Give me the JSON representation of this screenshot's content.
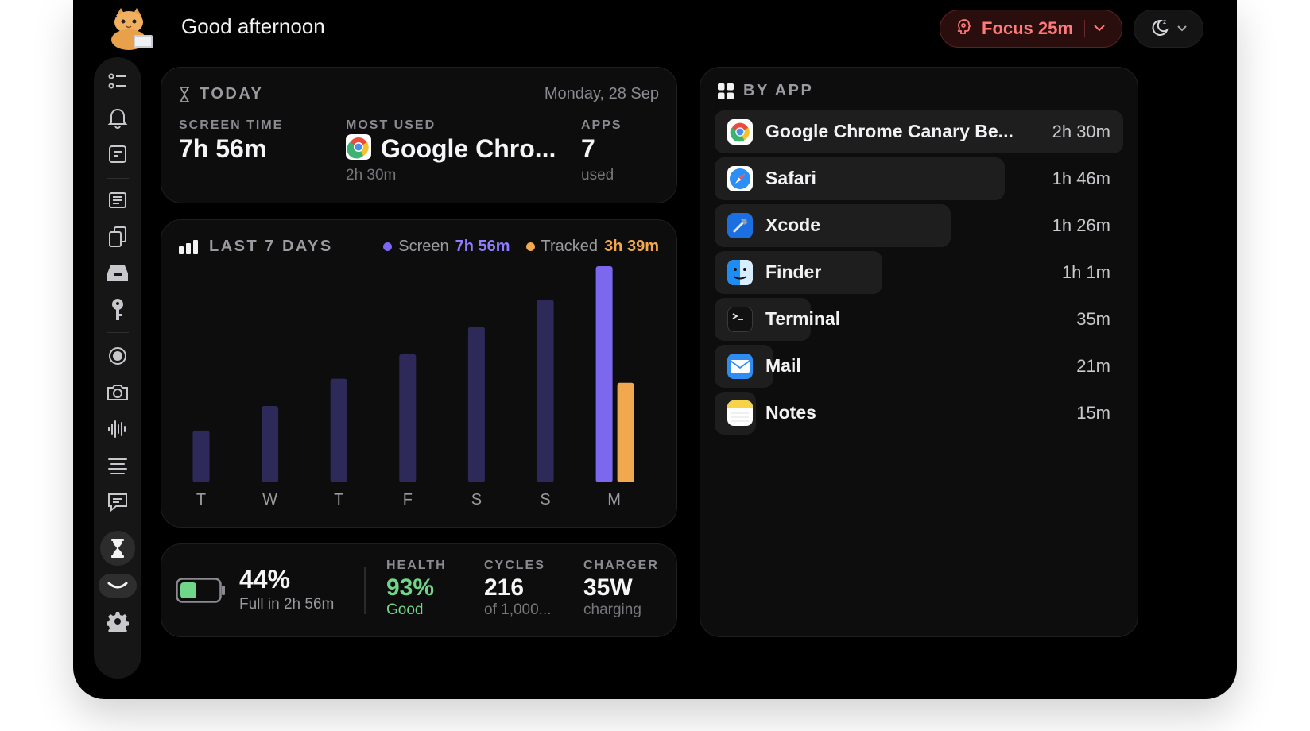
{
  "header": {
    "greeting": "Good afternoon",
    "focus_label": "Focus 25m"
  },
  "colors": {
    "screen": "#7b68ee",
    "screen_dim": "#2d2a5a",
    "tracked": "#f2a84e",
    "health_good": "#6fd68a",
    "focus": "#ff7a7a"
  },
  "sidebar": {
    "icons": [
      "checklist-icon",
      "bell-icon",
      "note-icon",
      "document-icon",
      "copy-icon",
      "inbox-icon",
      "key-icon",
      "record-icon",
      "camera-icon",
      "waveform-icon",
      "text-align-icon",
      "chat-icon",
      "hourglass-icon",
      "smile-toggle-icon",
      "gear-icon"
    ],
    "active": "hourglass-icon"
  },
  "today": {
    "title": "TODAY",
    "date": "Monday, 28 Sep",
    "screen_time_label": "SCREEN TIME",
    "screen_time_value": "7h 56m",
    "most_used_label": "MOST USED",
    "most_used_value": "Google Chro...",
    "most_used_sub": "2h 30m",
    "apps_label": "APPS",
    "apps_value": "7",
    "apps_sub": "used"
  },
  "week": {
    "title": "LAST 7 DAYS",
    "screen_label": "Screen",
    "screen_value": "7h 56m",
    "tracked_label": "Tracked",
    "tracked_value": "3h 39m"
  },
  "chart_data": {
    "type": "bar",
    "categories": [
      "T",
      "W",
      "T",
      "F",
      "S",
      "S",
      "M"
    ],
    "series": [
      {
        "name": "Screen",
        "values": [
          1.9,
          2.8,
          3.8,
          4.7,
          5.7,
          6.7,
          7.93
        ]
      },
      {
        "name": "Tracked",
        "values": [
          null,
          null,
          null,
          null,
          null,
          null,
          3.65
        ]
      }
    ],
    "ylim": [
      0,
      7.93
    ],
    "grid": false,
    "legend": "top-right"
  },
  "battery": {
    "level": 0.44,
    "percent": "44%",
    "sub": "Full in 2h 56m",
    "health_label": "HEALTH",
    "health_value": "93%",
    "health_sub": "Good",
    "cycles_label": "CYCLES",
    "cycles_value": "216",
    "cycles_sub": "of 1,000...",
    "charger_label": "CHARGER",
    "charger_value": "35W",
    "charger_sub": "charging"
  },
  "by_app": {
    "title": "BY APP",
    "apps": [
      {
        "name": "Google Chrome Canary Be...",
        "time": "2h 30m",
        "share": 1.0,
        "icon": "chrome-canary-icon"
      },
      {
        "name": "Safari",
        "time": "1h 46m",
        "share": 0.71,
        "icon": "safari-icon"
      },
      {
        "name": "Xcode",
        "time": "1h 26m",
        "share": 0.577,
        "icon": "xcode-icon"
      },
      {
        "name": "Finder",
        "time": "1h 1m",
        "share": 0.41,
        "icon": "finder-icon"
      },
      {
        "name": "Terminal",
        "time": "35m",
        "share": 0.235,
        "icon": "terminal-icon"
      },
      {
        "name": "Mail",
        "time": "21m",
        "share": 0.143,
        "icon": "mail-icon"
      },
      {
        "name": "Notes",
        "time": "15m",
        "share": 0.1,
        "icon": "notes-icon"
      }
    ]
  }
}
